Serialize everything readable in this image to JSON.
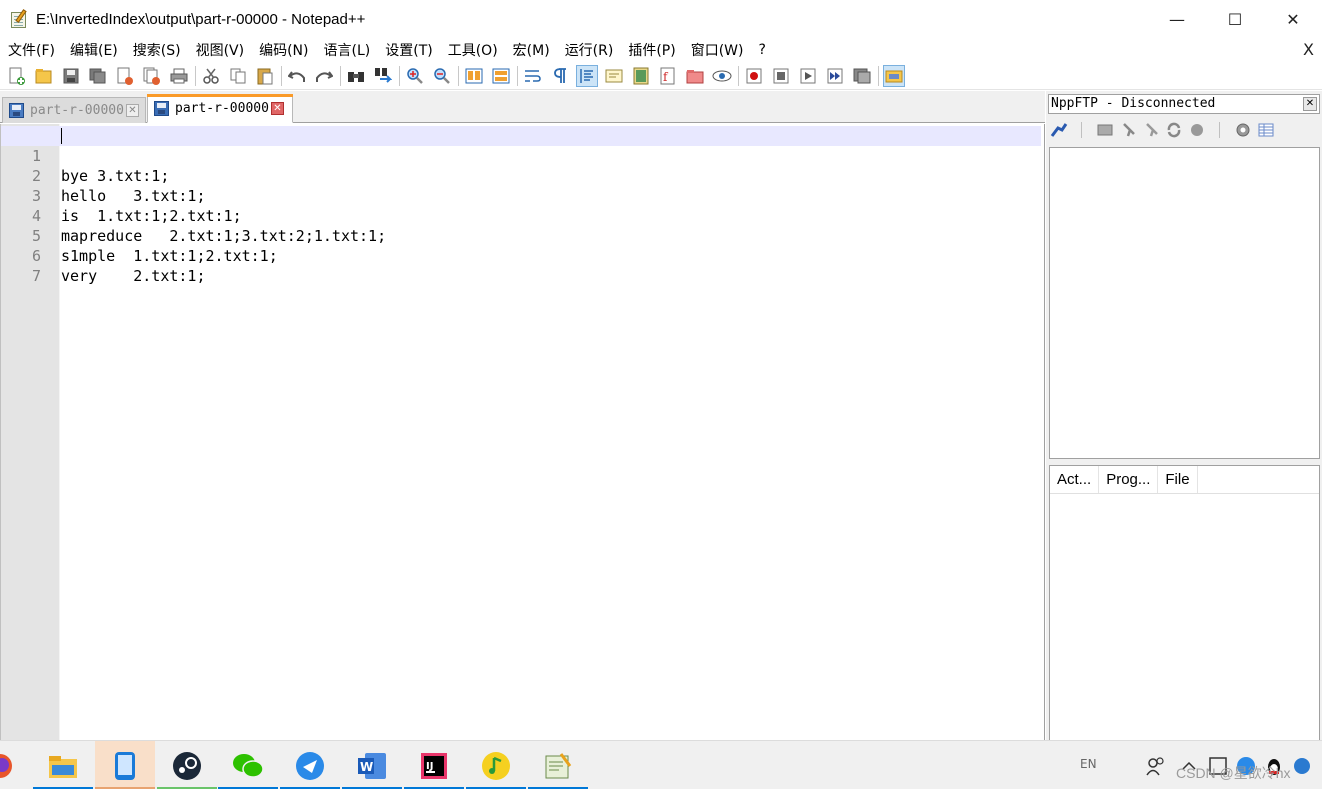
{
  "window": {
    "title": "E:\\InvertedIndex\\output\\part-r-00000 - Notepad++",
    "minimize": "—",
    "maximize": "☐",
    "close": "✕"
  },
  "menu": {
    "items": [
      "文件(F)",
      "编辑(E)",
      "搜索(S)",
      "视图(V)",
      "编码(N)",
      "语言(L)",
      "设置(T)",
      "工具(O)",
      "宏(M)",
      "运行(R)",
      "插件(P)",
      "窗口(W)",
      "?"
    ],
    "close": "X"
  },
  "toolbar": {
    "icons": [
      "new-file-icon",
      "open-file-icon",
      "save-icon",
      "save-all-icon",
      "close-icon",
      "close-all-icon",
      "print-icon",
      "cut-icon",
      "copy-icon",
      "paste-icon",
      "undo-icon",
      "redo-icon",
      "find-icon",
      "replace-icon",
      "zoom-in-icon",
      "zoom-out-icon",
      "sync-vertical-icon",
      "sync-horizontal-icon",
      "word-wrap-icon",
      "show-all-characters-icon",
      "indent-guide-icon",
      "user-language-icon",
      "document-map-icon",
      "function-list-icon",
      "folder-as-workspace-icon",
      "monitoring-icon",
      "record-macro-icon",
      "stop-macro-icon",
      "play-macro-icon",
      "run-macro-multiple-icon",
      "save-macro-icon",
      "nppftp-icon"
    ]
  },
  "tabs": [
    {
      "label": "part-r-00000",
      "active": false
    },
    {
      "label": "part-r-00000",
      "active": true
    }
  ],
  "editor": {
    "lines": [
      {
        "num": "1",
        "text": "bye 3.txt:1;"
      },
      {
        "num": "2",
        "text": "hello   3.txt:1;"
      },
      {
        "num": "3",
        "text": "is  1.txt:1;2.txt:1;"
      },
      {
        "num": "4",
        "text": "mapreduce   2.txt:1;3.txt:2;1.txt:1;"
      },
      {
        "num": "5",
        "text": "s1mple  1.txt:1;2.txt:1;"
      },
      {
        "num": "6",
        "text": "very    2.txt:1;"
      },
      {
        "num": "7",
        "text": ""
      }
    ],
    "current_line": 1
  },
  "nppftp": {
    "title": "NppFTP - Disconnected",
    "close": "✕",
    "queue_columns": [
      "Act...",
      "Prog...",
      "File"
    ]
  },
  "taskbar": {
    "apps": [
      "firefox-icon",
      "file-explorer-icon",
      "phone-link-icon",
      "steam-icon",
      "wechat-icon",
      "feishu-icon",
      "word-icon",
      "intellij-icon",
      "qq-music-icon",
      "notepadpp-icon"
    ],
    "language": "EN",
    "watermark": "CSDN @星欲冷hx"
  },
  "colors": {
    "current_line": "#e8e8ff",
    "gutter": "#e4e4e4",
    "active_tab_accent": "#fa9a28",
    "taskbar_underline": "#0078d7"
  }
}
